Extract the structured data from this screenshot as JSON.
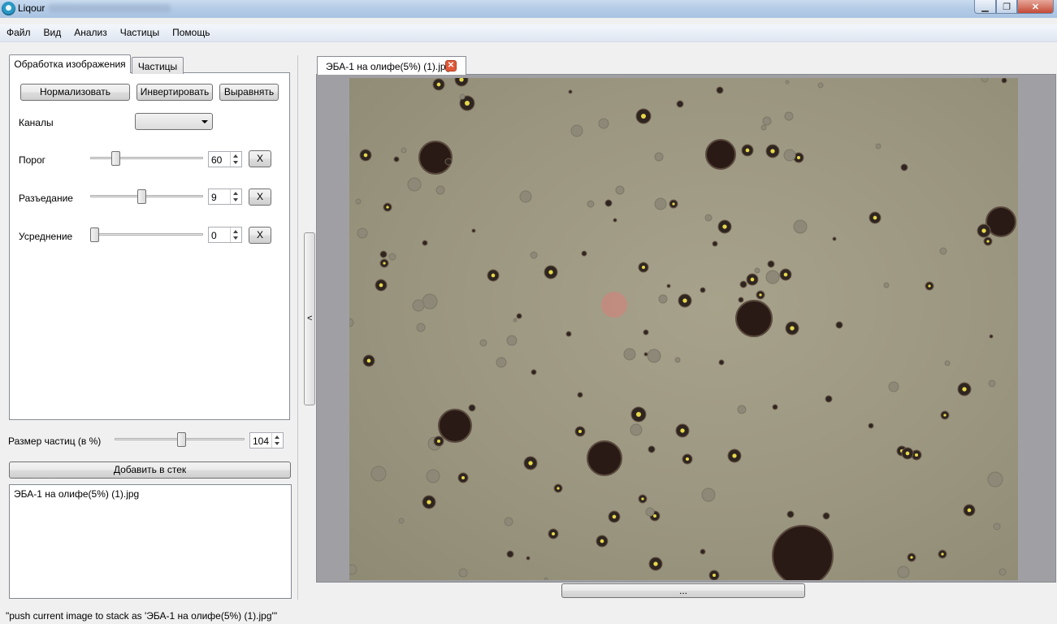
{
  "window": {
    "title": "Liqour"
  },
  "menu": [
    "Файл",
    "Вид",
    "Анализ",
    "Частицы",
    "Помощь"
  ],
  "left_tabs": {
    "active": "Обработка изображения",
    "other": "Частицы"
  },
  "toolbar": {
    "normalize": "Нормализовать",
    "invert": "Инвертировать",
    "align": "Выравнять"
  },
  "channels": {
    "label": "Каналы",
    "value": ""
  },
  "params": {
    "threshold": {
      "label": "Порог",
      "value": "60",
      "reset": "X",
      "level": 0.2
    },
    "erosion": {
      "label": "Разъедание",
      "value": "9",
      "reset": "X",
      "level": 0.45
    },
    "averaging": {
      "label": "Усреднение",
      "value": "0",
      "reset": "X",
      "level": 0.0
    }
  },
  "particle_size": {
    "label": "Размер частиц (в %)",
    "value": "104",
    "level": 0.52
  },
  "stack": {
    "add_button": "Добавить в стек",
    "items": [
      "ЭБА-1 на олифе(5%) (1).jpg"
    ]
  },
  "splitter": {
    "arrow": "<"
  },
  "document": {
    "tab_label": "ЭБА-1 на олифе(5%) (1).jpg",
    "close_glyph": "✕",
    "bottom_button": "..."
  },
  "status": "\"push current image to stack as 'ЭБА-1 на олифе(5%) (1).jpg'\""
}
